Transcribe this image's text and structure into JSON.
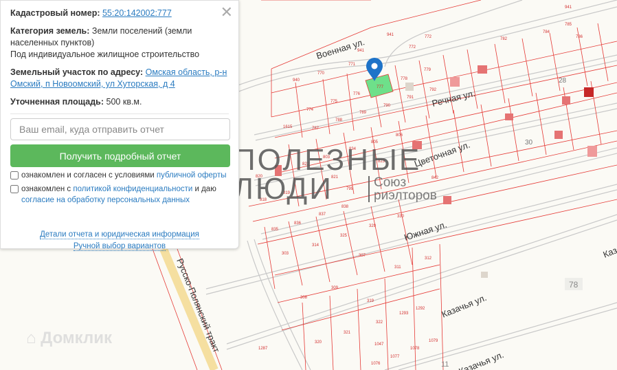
{
  "popup": {
    "cadastral_label": "Кадастровый номер:",
    "cadastral_number": "55:20:142002:777",
    "category_label": "Категория земель:",
    "category_value": "Земли поселений (земли населенных пунктов)",
    "usage": "Под индивидуальное жилищное строительство",
    "address_label": "Земельный участок по адресу:",
    "address_value": "Омская область, р-н Омский, п Новоомский, ул Хуторская, д 4",
    "area_label": "Уточненная площадь:",
    "area_value": "500 кв.м.",
    "email_placeholder": "Ваш email, куда отправить отчет",
    "submit_label": "Получить подробный отчет",
    "consent1_text": "ознакомлен и согласен с условиями ",
    "consent1_link": "публичной оферты",
    "consent2_text": "ознакомлен с ",
    "consent2_link": "политикой конфиденциальности",
    "consent2_mid": " и даю ",
    "consent2_link2": "согласие на обработку персональных данных",
    "details_link": "Детали отчета и юридическая информация",
    "manual_link": "Ручной выбор вариантов",
    "close_icon": "close-icon"
  },
  "map": {
    "streets": [
      "Военная ул.",
      "Речная ул.",
      "Цветочная ул.",
      "Южная ул.",
      "Казачья ул.",
      "Каз",
      "Казачья ул.",
      "Русско-Полянский тракт"
    ],
    "parcels": [
      "941",
      "941",
      "772",
      "772",
      "771",
      "770",
      "940",
      "776",
      "777",
      "778",
      "779",
      "775",
      "774",
      "790",
      "791",
      "792",
      "789",
      "788",
      "1615",
      "787",
      "805",
      "806",
      "834",
      "803",
      "823",
      "822",
      "821",
      "820",
      "819",
      "818",
      "838",
      "837",
      "836",
      "835",
      "799",
      "842",
      "329",
      "330",
      "325",
      "314",
      "307",
      "311",
      "312",
      "303",
      "319",
      "309",
      "308",
      "322",
      "321",
      "320",
      "1287",
      "1047",
      "1076",
      "1077",
      "1078",
      "1079",
      "1292",
      "1293",
      "785",
      "784",
      "786",
      "28",
      "30",
      "78",
      "11",
      "941",
      "782"
    ],
    "pin_icon": "map-pin-icon",
    "selected_color": "#6ee08a"
  },
  "watermark": {
    "title_line1": "ПОЛЕЗНЫЕ",
    "title_line2": "ЛЮДИ",
    "sub_line1": "Союз",
    "sub_line2": "риэлторов"
  },
  "brand_watermark": "Домклик"
}
